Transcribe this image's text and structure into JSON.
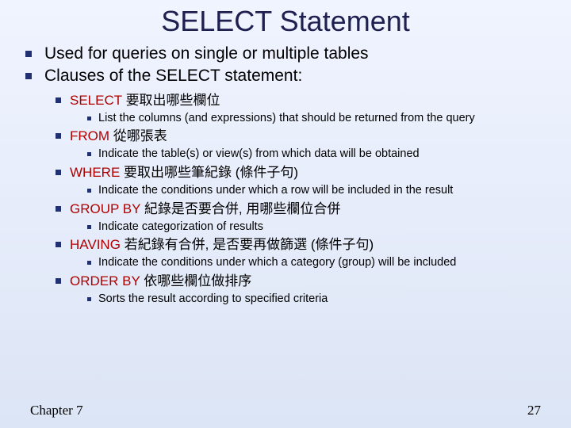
{
  "title": "SELECT Statement",
  "main": [
    "Used for queries on single or multiple tables",
    "Clauses of the SELECT statement:"
  ],
  "clauses": [
    {
      "kw": "SELECT",
      "zh": "要取出哪些欄位",
      "desc": "List the columns (and expressions) that should be returned from the query"
    },
    {
      "kw": "FROM",
      "zh": "從哪張表",
      "desc": "Indicate the table(s) or view(s) from which data will be obtained"
    },
    {
      "kw": "WHERE",
      "zh": "要取出哪些筆紀錄 (條件子句)",
      "desc": "Indicate the conditions under which a row will be included in the result"
    },
    {
      "kw": "GROUP BY",
      "zh": "紀錄是否要合併, 用哪些欄位合併",
      "desc": "Indicate categorization of results"
    },
    {
      "kw": "HAVING",
      "zh": "若紀錄有合併, 是否要再做篩選 (條件子句)",
      "desc": "Indicate the conditions under which a category (group) will be included"
    },
    {
      "kw": "ORDER BY",
      "zh": "依哪些欄位做排序",
      "desc": "Sorts the result according to specified criteria"
    }
  ],
  "footer": {
    "left": "Chapter 7",
    "right": "27"
  }
}
